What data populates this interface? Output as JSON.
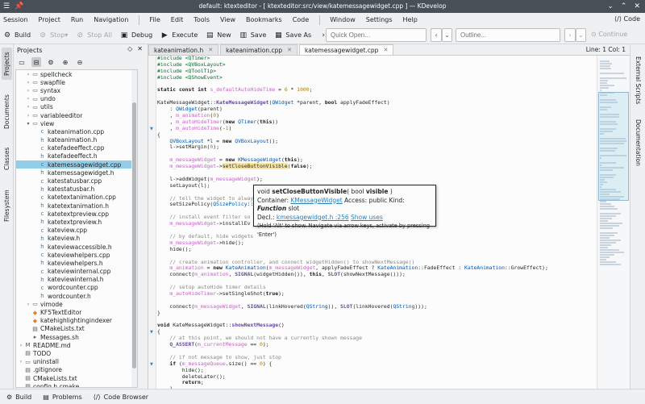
{
  "window": {
    "title": "default: ktexteditor - [ ktexteditor:src/view/katemessagewidget.cpp ] — KDevelop"
  },
  "menubar": {
    "items": [
      "Session",
      "Project",
      "Run",
      "Navigation",
      "File",
      "Edit",
      "Tools",
      "View",
      "Bookmarks",
      "Code",
      "Window",
      "Settings",
      "Help"
    ],
    "code_button": "Code"
  },
  "toolbar": {
    "build": "Build",
    "stop": "Stop",
    "stop_all": "Stop All",
    "debug": "Debug",
    "execute": "Execute",
    "new": "New",
    "save": "Save",
    "save_as": "Save As",
    "quick_open_placeholder": "Quick Open...",
    "outline_placeholder": "Outline...",
    "continue": "Continue"
  },
  "left_dock": {
    "tabs": [
      "Projects",
      "Documents",
      "Classes",
      "Filesystem"
    ]
  },
  "right_dock": {
    "tabs": [
      "External Scripts",
      "Documentation"
    ]
  },
  "projects": {
    "title": "Projects",
    "tree": [
      {
        "label": "spellcheck",
        "indent": 1,
        "type": "folder",
        "expand": "closed"
      },
      {
        "label": "swapfile",
        "indent": 1,
        "type": "folder",
        "expand": "closed"
      },
      {
        "label": "syntax",
        "indent": 1,
        "type": "folder",
        "expand": "closed"
      },
      {
        "label": "undo",
        "indent": 1,
        "type": "folder",
        "expand": "closed"
      },
      {
        "label": "utils",
        "indent": 1,
        "type": "folder",
        "expand": "closed"
      },
      {
        "label": "variableeditor",
        "indent": 1,
        "type": "folder",
        "expand": "closed"
      },
      {
        "label": "view",
        "indent": 1,
        "type": "folder",
        "expand": "open"
      },
      {
        "label": "kateanimation.cpp",
        "indent": 2,
        "type": "cpp"
      },
      {
        "label": "kateanimation.h",
        "indent": 2,
        "type": "h"
      },
      {
        "label": "katefadeeffect.cpp",
        "indent": 2,
        "type": "cpp"
      },
      {
        "label": "katefadeeffect.h",
        "indent": 2,
        "type": "h"
      },
      {
        "label": "katemessagewidget.cpp",
        "indent": 2,
        "type": "cpp",
        "selected": true
      },
      {
        "label": "katemessagewidget.h",
        "indent": 2,
        "type": "h"
      },
      {
        "label": "katestatusbar.cpp",
        "indent": 2,
        "type": "cpp"
      },
      {
        "label": "katestatusbar.h",
        "indent": 2,
        "type": "h"
      },
      {
        "label": "katetextanimation.cpp",
        "indent": 2,
        "type": "cpp"
      },
      {
        "label": "katetextanimation.h",
        "indent": 2,
        "type": "h"
      },
      {
        "label": "katetextpreview.cpp",
        "indent": 2,
        "type": "cpp"
      },
      {
        "label": "katetextpreview.h",
        "indent": 2,
        "type": "h"
      },
      {
        "label": "kateview.cpp",
        "indent": 2,
        "type": "cpp"
      },
      {
        "label": "kateview.h",
        "indent": 2,
        "type": "h"
      },
      {
        "label": "kateviewaccessible.h",
        "indent": 2,
        "type": "h"
      },
      {
        "label": "kateviewhelpers.cpp",
        "indent": 2,
        "type": "cpp"
      },
      {
        "label": "kateviewhelpers.h",
        "indent": 2,
        "type": "h"
      },
      {
        "label": "kateviewinternal.cpp",
        "indent": 2,
        "type": "cpp"
      },
      {
        "label": "kateviewinternal.h",
        "indent": 2,
        "type": "h"
      },
      {
        "label": "wordcounter.cpp",
        "indent": 2,
        "type": "cpp"
      },
      {
        "label": "wordcounter.h",
        "indent": 2,
        "type": "h"
      },
      {
        "label": "vimode",
        "indent": 1,
        "type": "folder",
        "expand": "closed"
      },
      {
        "label": "KF5TextEditor",
        "indent": 1,
        "type": "target"
      },
      {
        "label": "katehighlightingindexer",
        "indent": 1,
        "type": "target"
      },
      {
        "label": "CMakeLists.txt",
        "indent": 1,
        "type": "txt"
      },
      {
        "label": "Messages.sh",
        "indent": 1,
        "type": "sh"
      },
      {
        "label": "README.md",
        "indent": 0,
        "type": "md",
        "expand": "closed"
      },
      {
        "label": "TODO",
        "indent": 0,
        "type": "txt"
      },
      {
        "label": "uninstall",
        "indent": 0,
        "type": "folder",
        "expand": "closed"
      },
      {
        "label": ".gitignore",
        "indent": 0,
        "type": "txt"
      },
      {
        "label": "CMakeLists.txt",
        "indent": 0,
        "type": "txt"
      },
      {
        "label": "config.h.cmake",
        "indent": 0,
        "type": "txt"
      }
    ]
  },
  "editor": {
    "tabs": [
      {
        "label": "kateanimation.h",
        "active": false
      },
      {
        "label": "kateanimation.cpp",
        "active": false
      },
      {
        "label": "katemessagewidget.cpp",
        "active": true
      }
    ],
    "cursor": "Line: 1 Col: 1",
    "code_lines": [
      "#include <QTimer>",
      "#include <QVBoxLayout>",
      "#include <QToolTip>",
      "#include <QShowEvent>",
      "",
      "static const int s_defaultAutoHideTime = 6 * 1000;",
      "",
      "KateMessageWidget::KateMessageWidget(QWidget *parent, bool applyFadeEffect)",
      "    : QWidget(parent)",
      "    , m_animation(0)",
      "    , m_autoHideTimer(new QTimer(this))",
      "    , m_autoHideTime(-1)",
      "{",
      "    QVBoxLayout *l = new QVBoxLayout();",
      "    l->setMargin(0);",
      "",
      "    m_messageWidget = new KMessageWidget(this);",
      "    m_messageWidget->setCloseButtonVisible(false);",
      "",
      "    l->addWidget(m_messageWidget);",
      "    setLayout(l);",
      "",
      "    // tell the widget to always",
      "    setSizePolicy(QSizePolicy::",
      "",
      "    // install event filter so",
      "    m_messageWidget->installEv",
      "",
      "    // by default, hide widgets",
      "    m_messageWidget->hide();",
      "    hide();",
      "",
      "    // create animation controller, and connect widgetHidden() to showNextMessage()",
      "    m_animation = new KateAnimation(m_messageWidget, applyFadeEffect ? KateAnimation::FadeEffect : KateAnimation::GrowEffect);",
      "    connect(m_animation, SIGNAL(widgetHidden()), this, SLOT(showNextMessage()));",
      "",
      "    // setup autoHide timer details",
      "    m_autoHideTimer->setSingleShot(true);",
      "",
      "    connect(m_messageWidget, SIGNAL(linkHovered(QString)), SLOT(linkHovered(QString)));",
      "}",
      "",
      "void KateMessageWidget::showNextMessage()",
      "{",
      "    // at this point, we should not have a currently shown message",
      "    Q_ASSERT(m_currentMessage == 0);",
      "",
      "    // if not message to show, just stop",
      "    if (m_messageQueue.size() == 0) {",
      "        hide();",
      "        deleteLater();",
      "        return;",
      "    }"
    ]
  },
  "tooltip": {
    "signature_prefix": "void ",
    "signature_name": "setCloseButtonVisible",
    "signature_open": "( bool ",
    "signature_param": "visible",
    "signature_close": " )",
    "container_label": "Container: ",
    "container_value": "KMessageWidget",
    "access_label": " Access: public Kind: ",
    "kind_value": "Function",
    "kind_suffix": " slot",
    "decl_label": "Decl.: ",
    "decl_value": "kmessagewidget.h :256",
    "show_uses": "Show uses",
    "hint": "(Hold 'Alt' to show. Navigate via arrow keys, activate by pressing 'Enter')"
  },
  "statusbar": {
    "build": "Build",
    "problems": "Problems",
    "code_browser": "Code Browser"
  }
}
